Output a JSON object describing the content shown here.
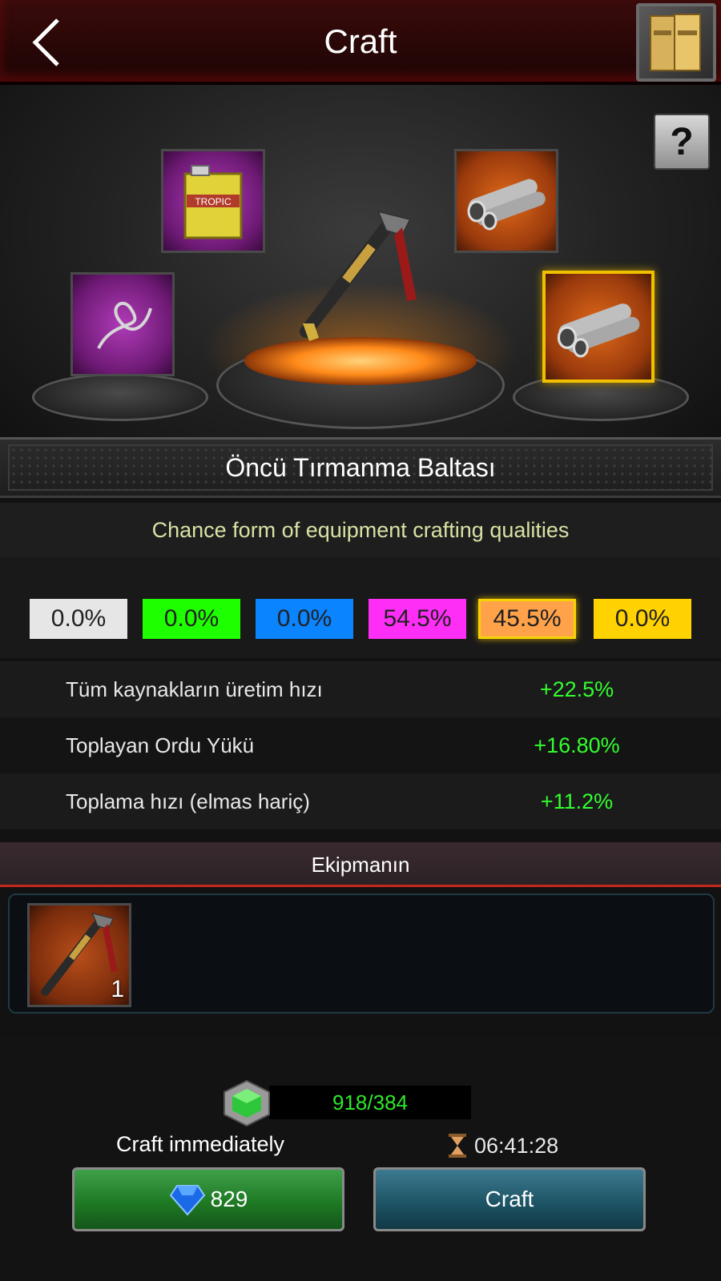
{
  "header": {
    "title": "Craft"
  },
  "scene": {
    "slots": [
      {
        "name": "slot-fuel-can",
        "rarity": "purple",
        "item": "fuel can",
        "can_label": "TROPIC"
      },
      {
        "name": "slot-steel-pipes-top",
        "rarity": "orange",
        "item": "steel pipes"
      },
      {
        "name": "slot-rope",
        "rarity": "purple",
        "item": "rope"
      },
      {
        "name": "slot-steel-pipes-selected",
        "rarity": "orange",
        "item": "steel pipes",
        "selected": true
      }
    ],
    "center_item": "ice axe",
    "help_label": "?"
  },
  "item_name": "Öncü Tırmanma Baltası",
  "chance_text": "Chance form of equipment crafting qualities",
  "qualities": [
    {
      "percent": "0.0%",
      "color": "#e6e6e6"
    },
    {
      "percent": "0.0%",
      "color": "#1eff00"
    },
    {
      "percent": "0.0%",
      "color": "#0a84ff"
    },
    {
      "percent": "54.5%",
      "color": "#ff2ef7"
    },
    {
      "percent": "45.5%",
      "color": "#ffa24a",
      "selected": true
    },
    {
      "percent": "0.0%",
      "color": "#ffd200"
    }
  ],
  "stats": [
    {
      "label": "Tüm kaynakların üretim hızı",
      "value": "+22.5%"
    },
    {
      "label": "Toplayan Ordu Yükü",
      "value": "+16.80%"
    },
    {
      "label": "Toplama hızı (elmas hariç)",
      "value": "+11.2%"
    }
  ],
  "equipment": {
    "title": "Ekipmanın",
    "item": {
      "icon": "ice axe",
      "count": "1"
    }
  },
  "resource": {
    "amount": "918/384"
  },
  "craft": {
    "immediately_label": "Craft immediately",
    "gem_cost": "829",
    "timer": "06:41:28",
    "craft_label": "Craft"
  },
  "colors": {
    "stat_value": "#33ff2e",
    "chance_text": "#d9e2a4",
    "header_bg": "#2a0707"
  }
}
